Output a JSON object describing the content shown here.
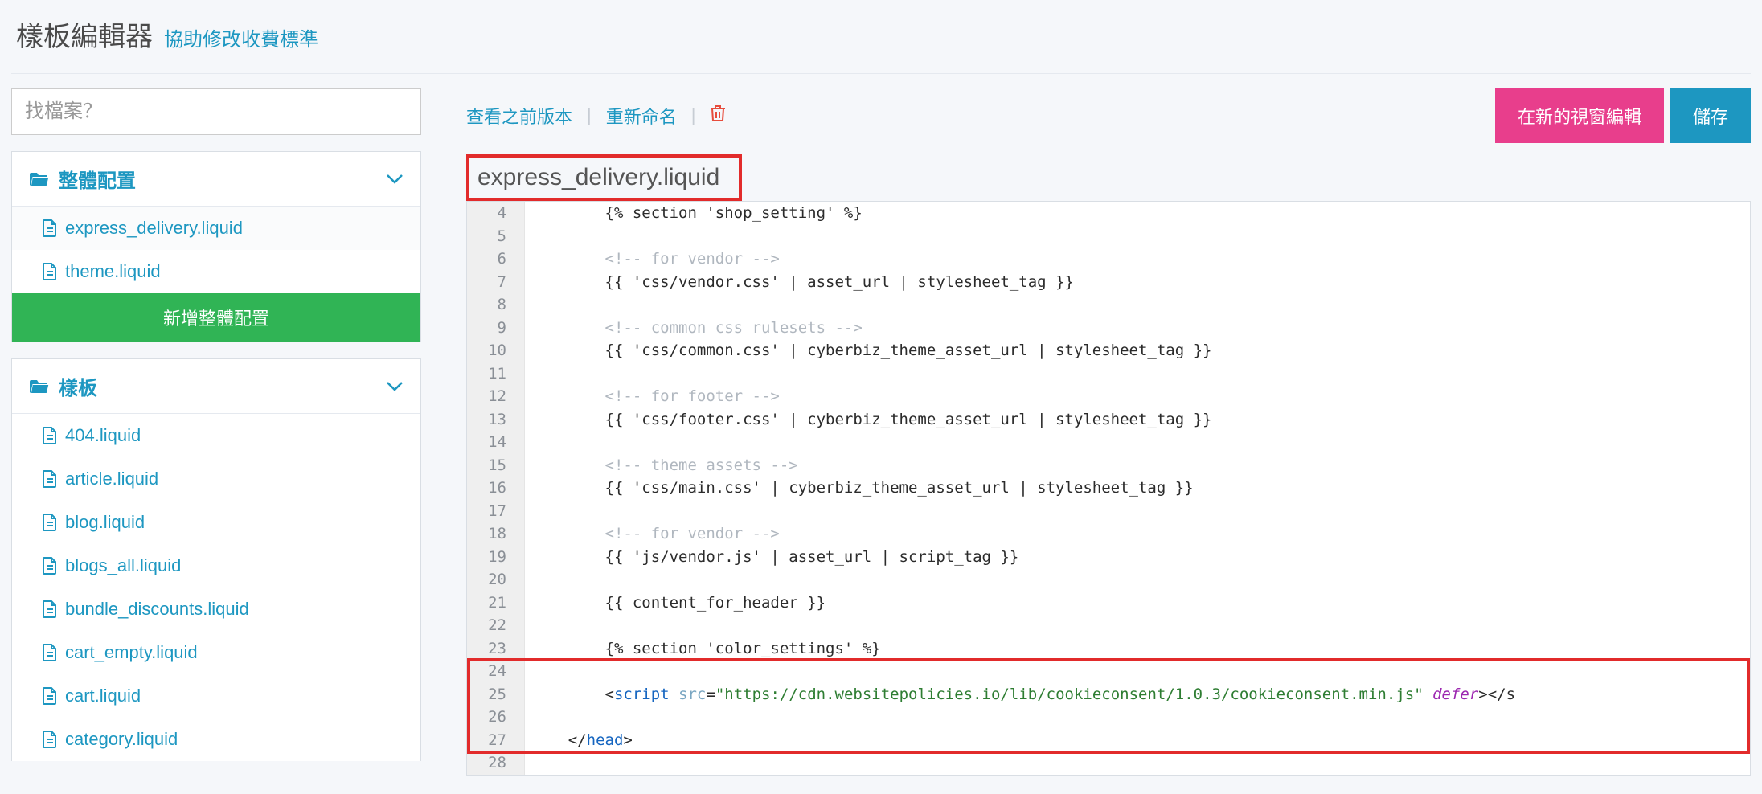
{
  "header": {
    "title": "樣板編輯器",
    "subtitle": "協助修改收費標準"
  },
  "search": {
    "placeholder": "找檔案？"
  },
  "panels": {
    "layout": {
      "title": "整體配置",
      "files": [
        "express_delivery.liquid",
        "theme.liquid"
      ],
      "add_button": "新增整體配置"
    },
    "templates": {
      "title": "樣板",
      "files": [
        "404.liquid",
        "article.liquid",
        "blog.liquid",
        "blogs_all.liquid",
        "bundle_discounts.liquid",
        "cart_empty.liquid",
        "cart.liquid",
        "category.liquid"
      ]
    }
  },
  "toolbar": {
    "prev_version": "查看之前版本",
    "rename": "重新命名",
    "edit_new_window": "在新的視窗編輯",
    "save": "儲存"
  },
  "editor": {
    "filename": "express_delivery.liquid",
    "lines": [
      {
        "n": 4,
        "indent": "        ",
        "raw": "{% section 'shop_setting' %}"
      },
      {
        "n": 5,
        "indent": "",
        "raw": ""
      },
      {
        "n": 6,
        "indent": "        ",
        "comment": "<!-- for vendor -->"
      },
      {
        "n": 7,
        "indent": "        ",
        "raw": "{{ 'css/vendor.css' | asset_url | stylesheet_tag }}"
      },
      {
        "n": 8,
        "indent": "",
        "raw": ""
      },
      {
        "n": 9,
        "indent": "        ",
        "comment": "<!-- common css rulesets -->"
      },
      {
        "n": 10,
        "indent": "        ",
        "raw": "{{ 'css/common.css' | cyberbiz_theme_asset_url | stylesheet_tag }}"
      },
      {
        "n": 11,
        "indent": "",
        "raw": ""
      },
      {
        "n": 12,
        "indent": "        ",
        "comment": "<!-- for footer -->"
      },
      {
        "n": 13,
        "indent": "        ",
        "raw": "{{ 'css/footer.css' | cyberbiz_theme_asset_url | stylesheet_tag }}"
      },
      {
        "n": 14,
        "indent": "",
        "raw": ""
      },
      {
        "n": 15,
        "indent": "        ",
        "comment": "<!-- theme assets -->"
      },
      {
        "n": 16,
        "indent": "        ",
        "raw": "{{ 'css/main.css' | cyberbiz_theme_asset_url | stylesheet_tag }}"
      },
      {
        "n": 17,
        "indent": "",
        "raw": ""
      },
      {
        "n": 18,
        "indent": "        ",
        "comment": "<!-- for vendor -->"
      },
      {
        "n": 19,
        "indent": "        ",
        "raw": "{{ 'js/vendor.js' | asset_url | script_tag }}"
      },
      {
        "n": 20,
        "indent": "",
        "raw": ""
      },
      {
        "n": 21,
        "indent": "        ",
        "raw": "{{ content_for_header }}"
      },
      {
        "n": 22,
        "indent": "",
        "raw": ""
      },
      {
        "n": 23,
        "indent": "        ",
        "raw": "{% section 'color_settings' %}"
      },
      {
        "n": 24,
        "indent": "",
        "raw": ""
      },
      {
        "n": 25,
        "indent": "        ",
        "script": {
          "tag": "script",
          "src": "\"https://cdn.websitepolicies.io/lib/cookieconsent/1.0.3/cookieconsent.min.js\"",
          "defer": "defer",
          "tail": "></s"
        }
      },
      {
        "n": 26,
        "indent": "",
        "raw": ""
      },
      {
        "n": 27,
        "indent": "    ",
        "closehead": "</head>"
      },
      {
        "n": 28,
        "indent": "",
        "raw": ""
      }
    ]
  }
}
